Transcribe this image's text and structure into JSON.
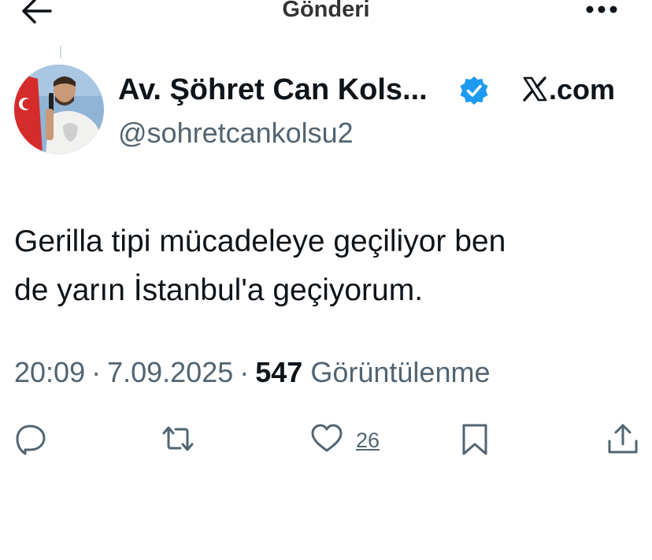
{
  "header": {
    "title": "Gönderi",
    "back_icon": "arrow-left-icon",
    "more_icon": "more-horizontal-icon"
  },
  "author": {
    "display_name": "Av. Şöhret Can Kols...",
    "handle": "@sohretcankolsu2",
    "verified": true,
    "verified_color": "#1d9bf0"
  },
  "watermark": {
    "brand": "X",
    "suffix": ".com"
  },
  "tweet": {
    "text_lines": [
      "Gerilla tipi mücadeleye geçiliyor ben",
      "de yarın İstanbul'a geçiyorum."
    ],
    "time": "20:09",
    "separator": "·",
    "date": "7.09.2025",
    "views_count": "547",
    "views_label": "Görüntülenme"
  },
  "actions": {
    "reply_icon": "reply-icon",
    "retweet_icon": "retweet-icon",
    "like_icon": "heart-icon",
    "like_count": "26",
    "bookmark_icon": "bookmark-icon",
    "share_icon": "share-icon"
  },
  "colors": {
    "text": "#0f1419",
    "secondary": "#536471",
    "accent": "#1d9bf0"
  }
}
